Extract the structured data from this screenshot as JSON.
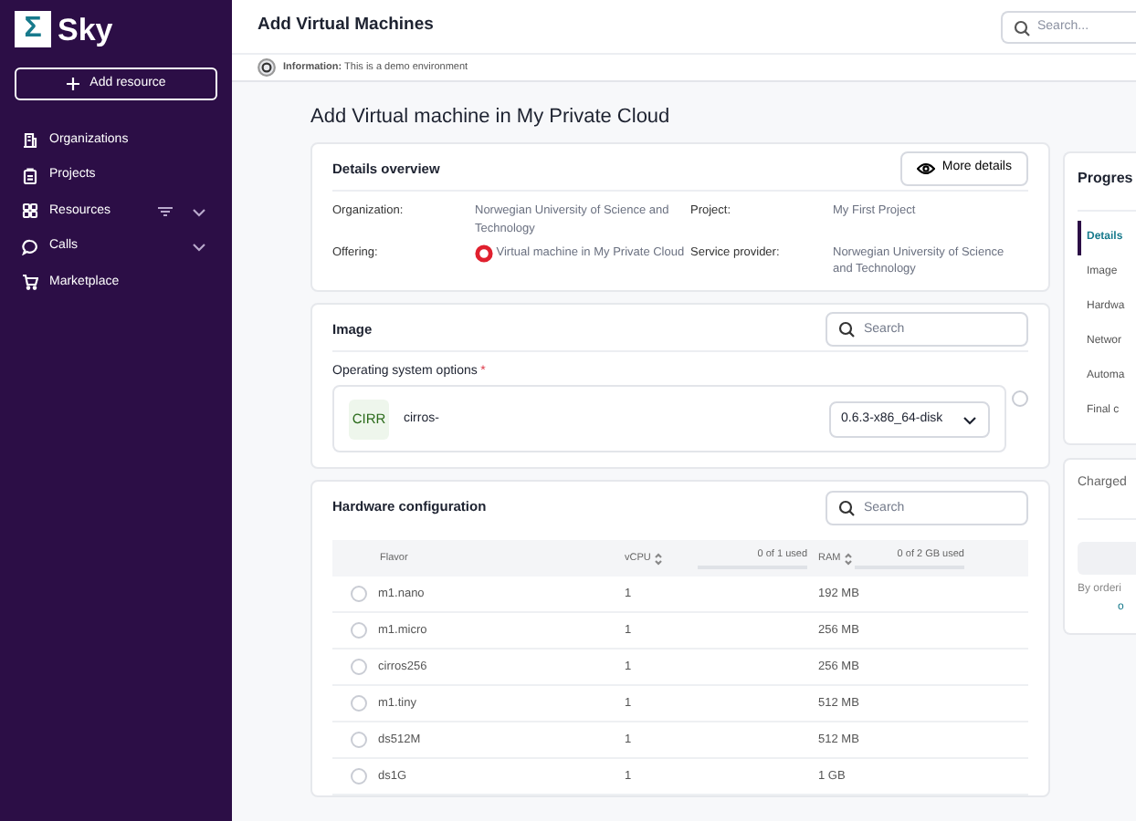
{
  "sidebar": {
    "logo_mark": "Σ",
    "brand": "Sky",
    "add_button": "Add resource",
    "items": [
      {
        "label": "Organizations",
        "expandable": false,
        "filter": false
      },
      {
        "label": "Projects",
        "expandable": false,
        "filter": false
      },
      {
        "label": "Resources",
        "expandable": true,
        "filter": true
      },
      {
        "label": "Calls",
        "expandable": true,
        "filter": false
      },
      {
        "label": "Marketplace",
        "expandable": false,
        "filter": false
      }
    ]
  },
  "header": {
    "title": "Add Virtual Machines",
    "search": {
      "placeholder": "Search..."
    }
  },
  "info_bar": {
    "text": "**Information:** This is a demo environment"
  },
  "page_title": "Add Virtual machine in My Private Cloud",
  "details": {
    "title": "Details overview",
    "button": "More details",
    "fields": [
      {
        "label": "Organization:",
        "value": "Norwegian University of Science and Technology",
        "logo": false
      },
      {
        "label": "Project:",
        "value": "My First Project",
        "logo": false
      },
      {
        "label": "Offering:",
        "value": "Virtual machine in My Private Cloud",
        "logo": true
      },
      {
        "label": "Service provider:",
        "value": "Norwegian University of Science and Technology",
        "logo": false
      }
    ]
  },
  "image": {
    "title": "Image",
    "search": {
      "placeholder": "Search"
    },
    "options_label": "Operating system options",
    "required_mark": "*",
    "options": [
      {
        "badge": "CIRR",
        "name": "cirros-",
        "version": "0.6.3-x86_64-disk",
        "selected": false
      }
    ]
  },
  "hardware": {
    "title": "Hardware configuration",
    "search": {
      "placeholder": "Search"
    },
    "columns": [
      "Flavor",
      "vCPU",
      "RAM"
    ],
    "quotas": [
      {
        "text": "0 of 1 used",
        "level": 0
      },
      {
        "text": "0 of 2 GB used",
        "level": 0
      }
    ],
    "rows": [
      {
        "flavor": "m1.nano",
        "vcpu": "1",
        "ram": "192 MB",
        "selected": false
      },
      {
        "flavor": "m1.micro",
        "vcpu": "1",
        "ram": "256 MB",
        "selected": false
      },
      {
        "flavor": "cirros256",
        "vcpu": "1",
        "ram": "256 MB",
        "selected": false
      },
      {
        "flavor": "m1.tiny",
        "vcpu": "1",
        "ram": "512 MB",
        "selected": false
      },
      {
        "flavor": "ds512M",
        "vcpu": "1",
        "ram": "512 MB",
        "selected": false
      },
      {
        "flavor": "ds1G",
        "vcpu": "1",
        "ram": "1 GB",
        "selected": false
      }
    ]
  },
  "progress": {
    "title": "Progres",
    "steps": [
      {
        "label": "Details",
        "selected": true
      },
      {
        "label": "Image",
        "selected": false
      },
      {
        "label": "Hardwa",
        "selected": false
      },
      {
        "label": "Networ",
        "selected": false
      },
      {
        "label": "Automa",
        "selected": false
      },
      {
        "label": "Final c",
        "selected": false
      }
    ]
  },
  "charges": {
    "title": "Charged",
    "note": "By orderi",
    "link": "o"
  }
}
